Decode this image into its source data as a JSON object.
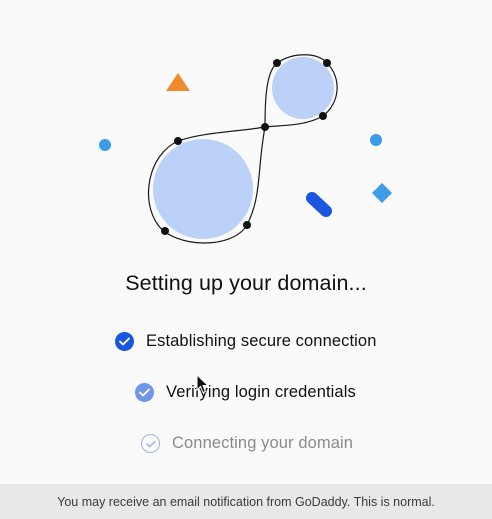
{
  "illustration": {
    "shapes": [
      "infinity-loop",
      "large-circle",
      "small-circle",
      "triangle",
      "dots",
      "pill",
      "diamond"
    ],
    "colors": {
      "circle_fill": "#bcd1f7",
      "loop_stroke": "#1a1a1a",
      "triangle": "#f08a2c",
      "dot_blue": "#3d9be8",
      "pill": "#1a56e0",
      "diamond": "#3d9be8"
    }
  },
  "title": "Setting up your domain...",
  "steps": [
    {
      "label": "Establishing secure connection",
      "status": "complete",
      "icon": "check-circle-filled-icon",
      "color": "#1a56e0"
    },
    {
      "label": "Verifying login credentials",
      "status": "in-progress",
      "icon": "check-circle-filled-icon",
      "color": "#6f95ec"
    },
    {
      "label": "Connecting your domain",
      "status": "pending",
      "icon": "check-circle-outline-icon",
      "color": "#9fb3de"
    }
  ],
  "footer": {
    "text": "You may receive an email notification from GoDaddy. This is normal."
  }
}
